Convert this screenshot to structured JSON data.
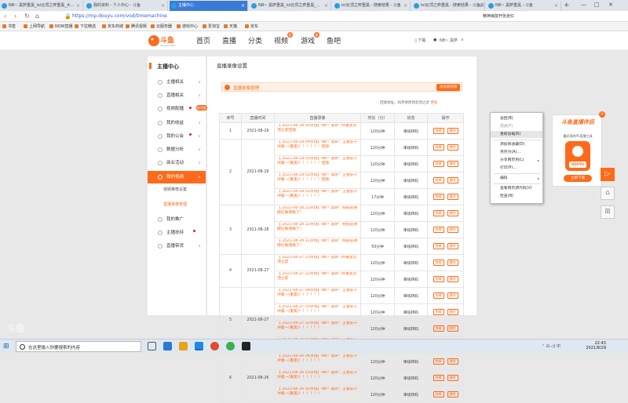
{
  "browser": {
    "tabs": [
      {
        "label": "NB~ 黑萨重黑_lol云顶之弈重黑_大...",
        "active": false
      },
      {
        "label": "我的资料 - 个人中心 - 斗鱼",
        "active": false
      },
      {
        "label": "主播中心",
        "active": true
      },
      {
        "label": "NB~ 黑萨重黑_lol云顶之弈重黑_...",
        "active": false
      },
      {
        "label": "lol云顶之弈重黑 - 搜索结果 - 斗鱼",
        "active": false
      },
      {
        "label": "lol云顶之弈重黑 - 搜索结果 - 斗鱼云",
        "active": false
      },
      {
        "label": "NB~ 黑萨重黑 - 斗鱼",
        "active": false
      }
    ],
    "new_tab": "+",
    "url": "https://mp.douyu.com/vod/timemachine",
    "right_text": "精神病院开张走红",
    "window_controls": [
      "—",
      "□",
      "✕"
    ]
  },
  "bookmarks": [
    "书签",
    "上网导航",
    "NOW直播",
    "下拉精选",
    "京东商城",
    "腾讯视频",
    "云服务器",
    "游戏中心",
    "爱淘宝",
    "天猫",
    "京东"
  ],
  "site": {
    "logo_text": "斗鱼",
    "logo_sub": "DOUYU.COM",
    "nav": [
      {
        "label": "首页",
        "badge": ""
      },
      {
        "label": "直播",
        "badge": ""
      },
      {
        "label": "分类",
        "badge": ""
      },
      {
        "label": "视频",
        "badge": "热"
      },
      {
        "label": "游戏",
        "badge": "新"
      },
      {
        "label": "鱼吧",
        "badge": ""
      }
    ],
    "download": "下载",
    "user": "NB~ 黑萨"
  },
  "sidebar": {
    "title": "主播中心",
    "items": [
      {
        "label": "主播相关",
        "arrow": "∨"
      },
      {
        "label": "直播相关",
        "arrow": "∨"
      },
      {
        "label": "视频配播",
        "arrow": "∨"
      },
      {
        "label": "我的收益",
        "arrow": "∨"
      },
      {
        "label": "我的公会",
        "arrow": "∨"
      },
      {
        "label": "数据分析",
        "arrow": "∨"
      },
      {
        "label": "商业活动",
        "arrow": "∨"
      },
      {
        "label": "我的视频",
        "arrow": "∧"
      },
      {
        "label": "我的推广",
        "arrow": ""
      },
      {
        "label": "主播扶持",
        "arrow": ""
      },
      {
        "label": "直播带货",
        "arrow": "∨"
      }
    ],
    "subitems": [
      "视频推荐设置",
      "直播录像管理"
    ],
    "new_tag": "新功能"
  },
  "main": {
    "title": "直播录像设置",
    "section_title": "直播录像管理",
    "action_button": "添加到视频",
    "sort_text": "回放地址、同步修改到云顶之弈 ",
    "sort_link": "更多",
    "columns": [
      "序号",
      "直播时间",
      "直播录像",
      "时长（分）",
      "状态",
      "操作"
    ],
    "op_labels": [
      "剪辑",
      "删除"
    ],
    "rows": [
      {
        "index": "1",
        "date": "2021-08-29",
        "videos": [
          {
            "text": "【 2021-08-29 05点场】NB~ 黑萨: lol重黑云顶之弈",
            "tag": "回放",
            "duration": "120分钟",
            "status": "审核转码"
          }
        ]
      },
      {
        "index": "2",
        "date": "2021-08-29",
        "videos": [
          {
            "text": "【 2021-08-29 04点场】NB~ 黑萨：王者前十冲第一(重黑)！！！！！！",
            "tag": "回放",
            "duration": "120分钟",
            "status": "审核转码"
          },
          {
            "text": "【 2021-08-29 03点场】NB~ 黑萨：王者前十冲第一(重黑)！！！！！！",
            "tag": "回放",
            "duration": "120分钟",
            "status": "审核转码"
          },
          {
            "text": "【 2021-08-29 02点场】NB~ 黑萨：王者前十冲第一(重黑)！！！！！！",
            "tag": "回放",
            "duration": "120分钟",
            "status": "审核转码"
          },
          {
            "text": "【 2021-08-29 01点场】NB~ 黑萨：王者前十冲第一(重黑)！！！！！！",
            "tag": "",
            "duration": "17分钟",
            "status": "审核转码"
          }
        ]
      },
      {
        "index": "3",
        "date": "2021-08-28",
        "videos": [
          {
            "text": "【 2021-08-28 23点场】NB~ 黑萨：把握前德德比肤德肤了！",
            "tag": "",
            "duration": "120分钟",
            "status": "审核转码"
          },
          {
            "text": "【 2021-08-28 22点场】NB~ 黑萨：把握前德德比肤德肤了！",
            "tag": "",
            "duration": "120分钟",
            "status": "审核转码"
          },
          {
            "text": "【 2021-08-28 21点场】NB~ 黑萨：把握前德德比肤德肤了！",
            "tag": "",
            "duration": "50分钟",
            "status": "审核转码"
          }
        ]
      },
      {
        "index": "4",
        "date": "2021-08-27",
        "videos": [
          {
            "text": "【 2021-08-27 23点场】NB~ 黑萨: lol重黑云顶之弈",
            "tag": "",
            "duration": "120分钟",
            "status": "审核转码"
          },
          {
            "text": "【 2021-08-27 22点场】NB~ 黑萨: lol重黑云顶之弈",
            "tag": "",
            "duration": "120分钟",
            "status": "审核转码"
          }
        ]
      },
      {
        "index": "5",
        "date": "2021-08-27",
        "videos": [
          {
            "text": "【 2021-08-27 04点场】NB~ 黑萨：王者前十冲第一(重黑)！！！！！！",
            "tag": "",
            "duration": "120分钟",
            "status": "审核转码"
          },
          {
            "text": "【 2021-08-27 03点场】NB~ 黑萨：王者前十冲第一(重黑)！！！！！！",
            "tag": "",
            "duration": "120分钟",
            "status": "审核转码"
          },
          {
            "text": "【 2021-08-27 02点场】NB~ 黑萨：王者前十冲第一(重黑)！！！！！！",
            "tag": "",
            "duration": "120分钟",
            "status": "审核转码"
          },
          {
            "text": "【 2021-08-27 01点场】NB~ 黑萨：王者前十冲第一(重黑)！！！！！！",
            "tag": "",
            "duration": "120分钟",
            "status": "审核转码"
          }
        ]
      },
      {
        "index": "6",
        "date": "2021-08-26",
        "videos": [
          {
            "text": "【 2021-08-26 04点场】NB~ 黑萨：王者前十冲第一(重黑)！！！！！！",
            "tag": "",
            "duration": "120分钟",
            "status": "审核转码"
          },
          {
            "text": "【 2021-08-26 03点场】NB~ 黑萨：王者前十冲第一(重黑)！！！！！！",
            "tag": "",
            "duration": "120分钟",
            "status": "审核转码"
          },
          {
            "text": "【 2021-08-26 02点场】NB~ 黑萨：王者前十冲第一(重黑)！！！！！！",
            "tag": "",
            "duration": "120分钟",
            "status": "审核转码"
          }
        ]
      }
    ]
  },
  "context_menu": {
    "items": [
      {
        "label": "返回(B)",
        "disabled": false,
        "sep_after": false,
        "submenu": false,
        "highlight": false
      },
      {
        "label": "前进(F)",
        "disabled": true,
        "sep_after": false,
        "submenu": false,
        "highlight": false
      },
      {
        "label": "重新加载(R)",
        "disabled": false,
        "sep_after": true,
        "submenu": false,
        "highlight": true
      },
      {
        "label": "添加到收藏(D)",
        "disabled": false,
        "sep_after": false,
        "submenu": false,
        "highlight": false
      },
      {
        "label": "另存为(A)...",
        "disabled": false,
        "sep_after": false,
        "submenu": false,
        "highlight": false
      },
      {
        "label": "分享网页到(L)",
        "disabled": false,
        "sep_after": false,
        "submenu": true,
        "highlight": false
      },
      {
        "label": "打印(P)...",
        "disabled": false,
        "sep_after": true,
        "submenu": false,
        "highlight": false
      },
      {
        "label": "编码",
        "disabled": false,
        "sep_after": true,
        "submenu": true,
        "highlight": false
      },
      {
        "label": "查看网页源代码(V)",
        "disabled": false,
        "sep_after": false,
        "submenu": false,
        "highlight": false
      },
      {
        "label": "检查(N)",
        "disabled": false,
        "sep_after": false,
        "submenu": false,
        "highlight": false
      }
    ]
  },
  "ad": {
    "title": "斗鱼直播伴侣",
    "subtitle": "最好用的PC直播工具",
    "logo_text": "DOUYU",
    "button": "立即下载",
    "close": "×"
  },
  "side_buttons": {
    "play": "▷",
    "home": "⌂",
    "app": "⊞"
  },
  "taskbar": {
    "start": "⊞",
    "search_placeholder": "在这里输入你要搜索的内容",
    "tray": "⌃ ⊟ ◁) 中",
    "time": "22:43",
    "date": "2021/8/29"
  },
  "watermark": "斗鱼",
  "colors": {
    "accent": "#ff6a1a",
    "tab_active": "#3b7bd8"
  }
}
